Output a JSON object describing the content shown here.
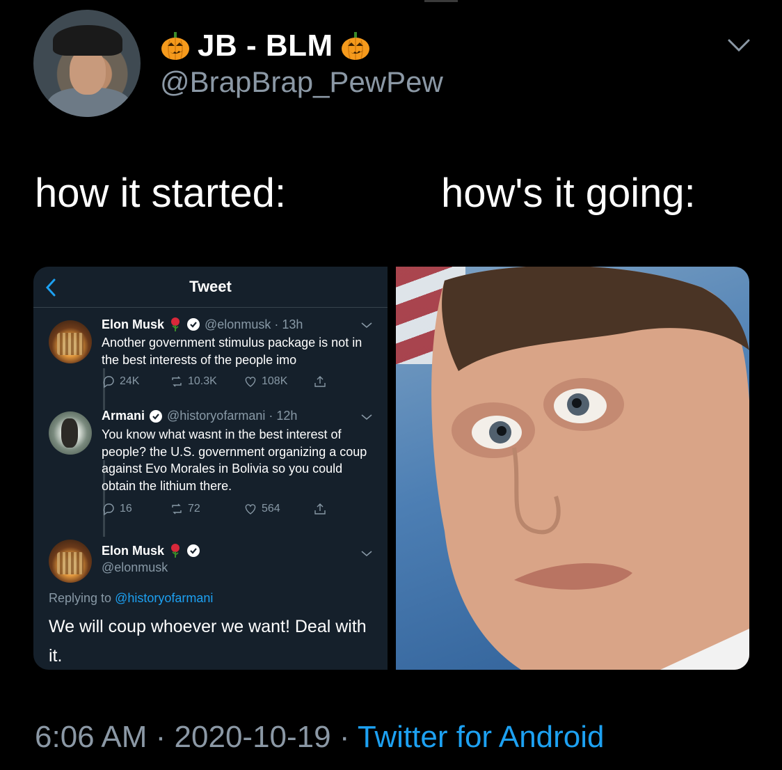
{
  "tweet": {
    "author": {
      "display_name": "JB - BLM",
      "handle": "@BrapBrap_PewPew",
      "avatar_icon": "cowboy-hat-avatar",
      "name_emoji": "pumpkin-icon"
    },
    "caption_left": "how it started:",
    "caption_right": "how's it going:",
    "timestamp": "6:06 AM · 2020-10-19 ·",
    "source": "Twitter for Android"
  },
  "embedded_screenshot": {
    "header_title": "Tweet",
    "tweets": [
      {
        "name": "Elon Musk",
        "handle": "@elonmusk · 13h",
        "text": "Another government stimulus package is not in the best interests of the people imo",
        "replies": "24K",
        "retweets": "10.3K",
        "likes": "108K"
      },
      {
        "name": "Armani",
        "handle": "@historyofarmani · 12h",
        "text": "You know what wasnt in the best interest of people? the U.S. government organizing a coup against Evo Morales in Bolivia so you could obtain the lithium there.",
        "replies": "16",
        "retweets": "72",
        "likes": "564"
      }
    ],
    "main_tweet": {
      "name": "Elon Musk",
      "handle": "@elonmusk",
      "replying_prefix": "Replying to",
      "replying_to": "@historyofarmani",
      "text": "We will coup whoever we want! Deal with it."
    }
  },
  "colors": {
    "background": "#000000",
    "panel_bg": "#15202b",
    "muted": "#8b98a5",
    "link": "#1da1f2"
  }
}
